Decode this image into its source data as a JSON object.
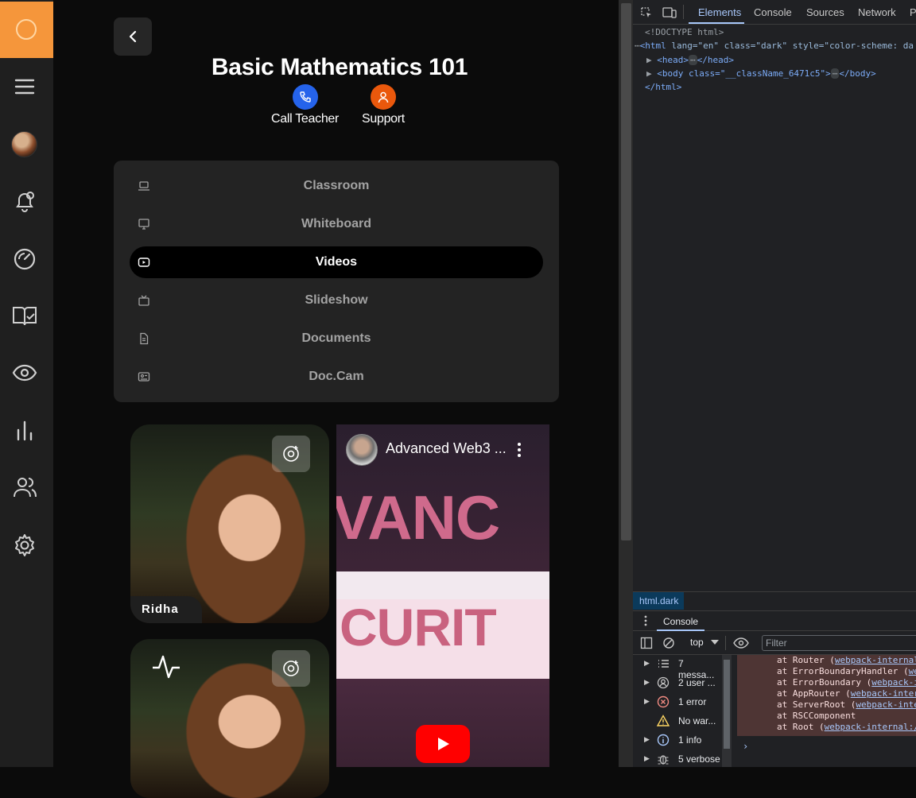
{
  "page": {
    "title": "Basic Mathematics 101",
    "actions": [
      {
        "label": "Call Teacher",
        "color": "#2563eb"
      },
      {
        "label": "Support",
        "color": "#ea580c"
      }
    ],
    "tabs": [
      {
        "label": "Classroom",
        "icon": "laptop-icon"
      },
      {
        "label": "Whiteboard",
        "icon": "presentation-icon"
      },
      {
        "label": "Videos",
        "icon": "video-icon",
        "active": true
      },
      {
        "label": "Slideshow",
        "icon": "tv-icon"
      },
      {
        "label": "Documents",
        "icon": "document-icon"
      },
      {
        "label": "Doc.Cam",
        "icon": "camera-card-icon"
      }
    ],
    "participant": {
      "name": "Ridha"
    },
    "video": {
      "title": "Advanced Web3 ...",
      "overlay_line1": "VANC",
      "overlay_line2": "CURIT"
    }
  },
  "sidebar": {
    "icons": [
      "menu-icon",
      "avatar",
      "bell-icon",
      "gauge-icon",
      "book-check-icon",
      "eye-icon",
      "bar-chart-icon",
      "users-icon",
      "settings-icon"
    ]
  },
  "devtools": {
    "tabs": [
      "Elements",
      "Console",
      "Sources",
      "Network",
      "P"
    ],
    "dom": {
      "doctype": "<!DOCTYPE html>",
      "html_open_tag": "<html",
      "html_attrs": "lang=\"en\" class=\"dark\" style=\"color-scheme: da",
      "head": "<head>",
      "head_close": "</head>",
      "body_open": "<body class=\"__className_6471c5\">",
      "body_close": "</body>",
      "html_close": "</html>",
      "ellipsis": "⋯"
    },
    "breadcrumb": "html.dark",
    "drawer_tab": "Console",
    "context": "top",
    "filter_placeholder": "Filter",
    "sidebar_rows": [
      {
        "text": "7 messa...",
        "icon": "list-icon"
      },
      {
        "text": "2 user ...",
        "icon": "user-icon"
      },
      {
        "text": "1 error",
        "icon": "error-icon"
      },
      {
        "text": "No war...",
        "icon": "warning-icon"
      },
      {
        "text": "1 info",
        "icon": "info-icon"
      },
      {
        "text": "5 verbose",
        "icon": "bug-icon"
      }
    ],
    "stack": [
      {
        "at": "at Router (",
        "link": "webpack-internal"
      },
      {
        "at": "at ErrorBoundaryHandler (",
        "link": "we"
      },
      {
        "at": "at ErrorBoundary (",
        "link": "webpack-i"
      },
      {
        "at": "at AppRouter (",
        "link": "webpack-inter"
      },
      {
        "at": "at ServerRoot (",
        "link": "webpack-inte"
      },
      {
        "at": "at RSCComponent",
        "link": ""
      },
      {
        "at": "at Root (",
        "link": "webpack-internal:/"
      }
    ]
  }
}
